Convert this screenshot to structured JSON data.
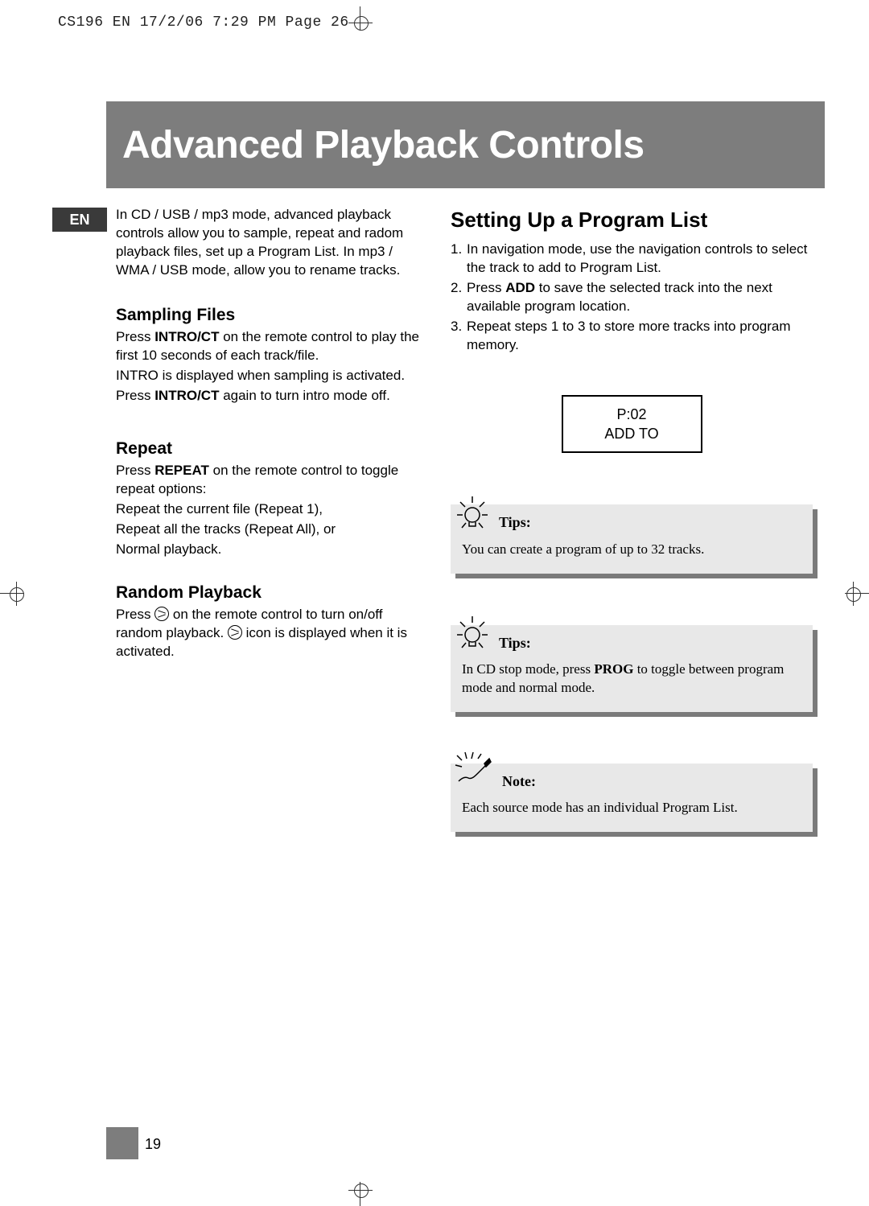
{
  "meta": {
    "header_line": "CS196 EN  17/2/06  7:29 PM  Page 26"
  },
  "title": "Advanced Playback Controls",
  "lang_badge": "EN",
  "left": {
    "intro": "In CD / USB / mp3 mode, advanced playback controls allow you to sample, repeat and radom playback files, set up a Program List. In mp3 / WMA / USB mode, allow you to rename tracks.",
    "sampling_h": "Sampling Files",
    "sampling_1a": "Press ",
    "sampling_1b": "INTRO/CT",
    "sampling_1c": " on the remote control to play the first 10 seconds of each track/file.",
    "sampling_2": "INTRO is displayed when sampling is activated.",
    "sampling_3a": "Press ",
    "sampling_3b": "INTRO/CT",
    "sampling_3c": " again to turn intro mode off.",
    "repeat_h": "Repeat",
    "repeat_1a": "Press ",
    "repeat_1b": "REPEAT",
    "repeat_1c": " on the remote control to toggle repeat options:",
    "repeat_2": "Repeat the current file (Repeat 1),",
    "repeat_3": "Repeat all the tracks (Repeat All), or",
    "repeat_4": "Normal playback.",
    "random_h": "Random Playback",
    "random_1a": "Press ",
    "random_1b": " on the remote control to turn on/off random playback. ",
    "random_1c": " icon is displayed when it is activated."
  },
  "right": {
    "program_h": "Setting Up a Program List",
    "step1": "In navigation mode, use the navigation controls to select the track to add to Program List.",
    "step2a": "Press ",
    "step2b": "ADD",
    "step2c": " to save the selected track into the next available program location.",
    "step3": "Repeat steps 1 to 3 to store more tracks into program memory.",
    "lcd_line1": "P:02",
    "lcd_line2": "ADD TO",
    "tip1_label": "Tips:",
    "tip1_body": "You can create a program of up to 32 tracks.",
    "tip2_label": "Tips:",
    "tip2_body_a": "In CD stop mode, press ",
    "tip2_body_b": "PROG",
    "tip2_body_c": " to toggle between program mode and normal mode.",
    "note_label": "Note:",
    "note_body": "Each source mode has an individual Program List."
  },
  "page_number": "19"
}
